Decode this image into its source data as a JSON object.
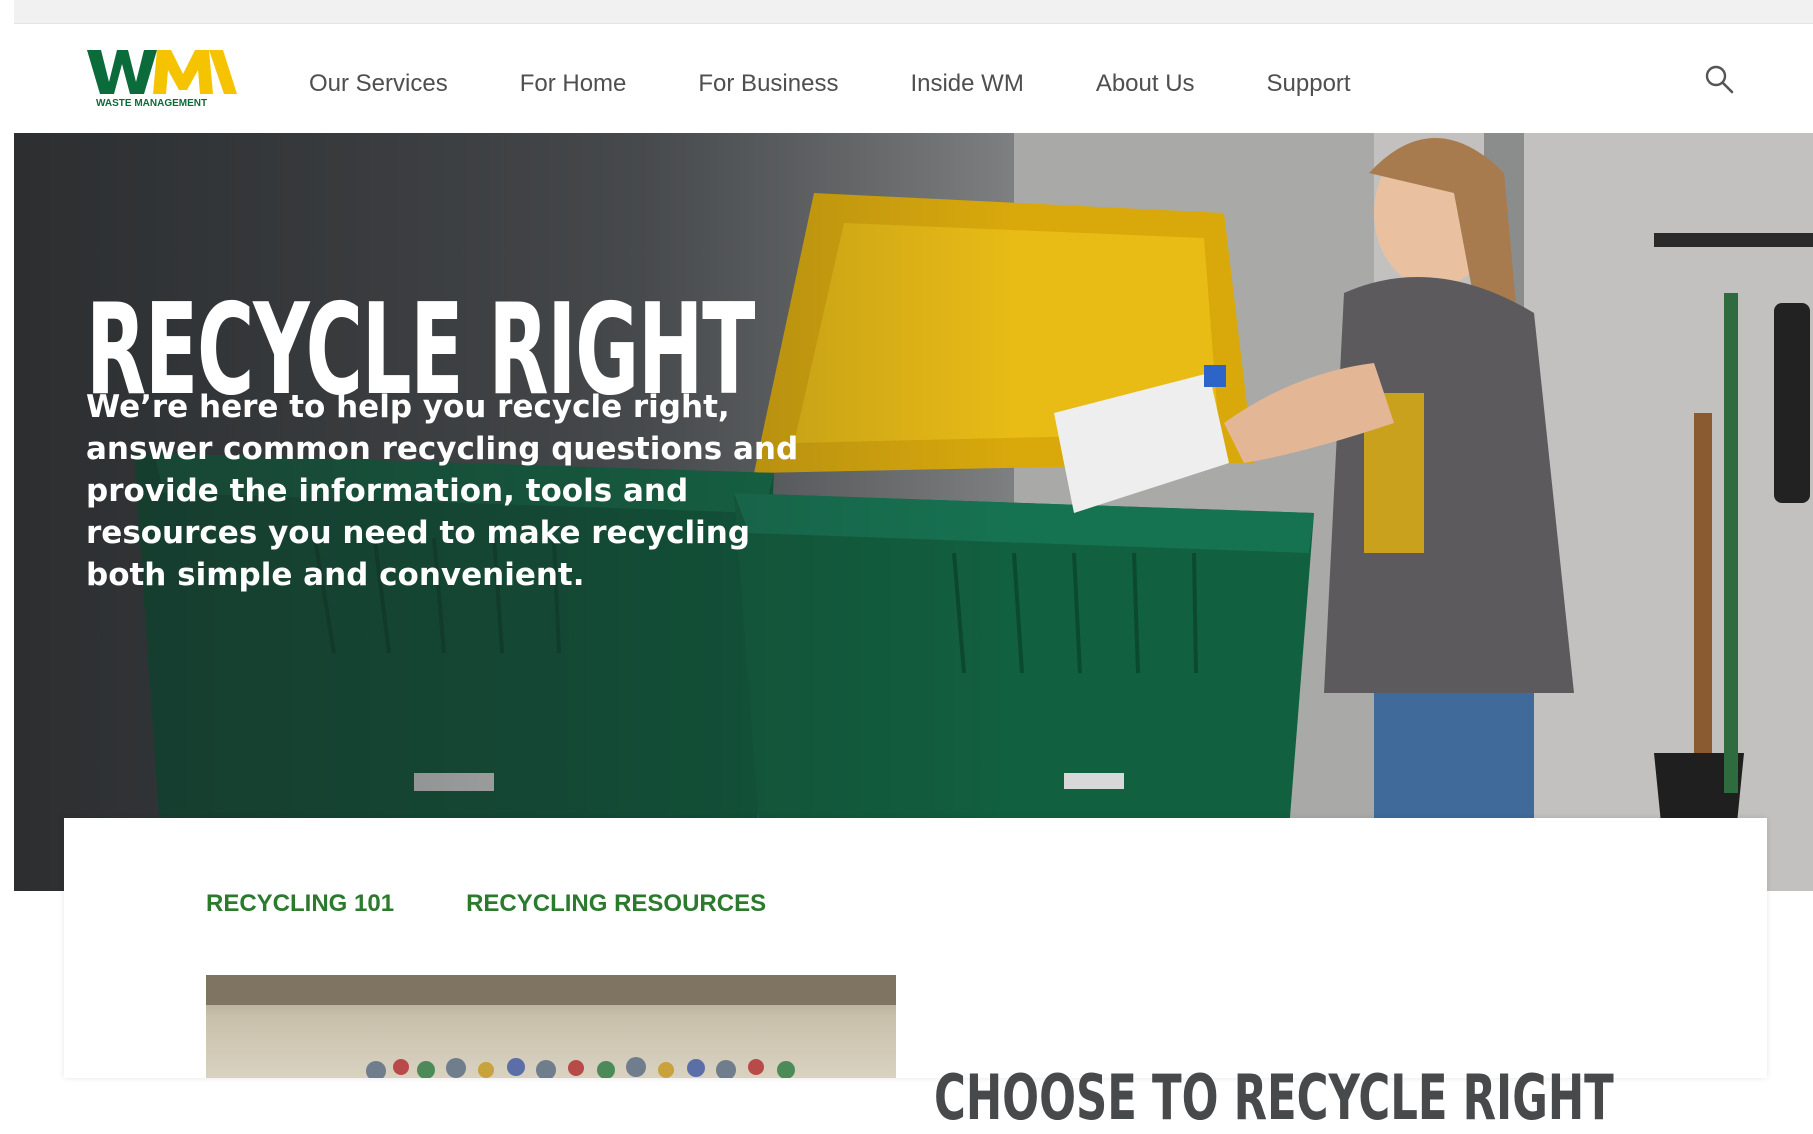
{
  "brand": {
    "logo_letters": "WM",
    "logo_tagline": "WASTE MANAGEMENT",
    "green": "#0c6b3a",
    "yellow": "#f5c300"
  },
  "nav": {
    "items": [
      {
        "label": "Our Services"
      },
      {
        "label": "For Home"
      },
      {
        "label": "For Business"
      },
      {
        "label": "Inside WM"
      },
      {
        "label": "About Us"
      },
      {
        "label": "Support"
      }
    ],
    "search_icon": "search-icon"
  },
  "hero": {
    "title": "RECYCLE RIGHT",
    "description": "We’re here to help you recycle right, answer common recycling questions and provide the information, tools and resources you need to make recycling both simple and convenient."
  },
  "tabs": [
    {
      "label": "RECYCLING 101"
    },
    {
      "label": "RECYCLING RESOURCES"
    }
  ],
  "section": {
    "title": "CHOOSE TO RECYCLE RIGHT"
  }
}
